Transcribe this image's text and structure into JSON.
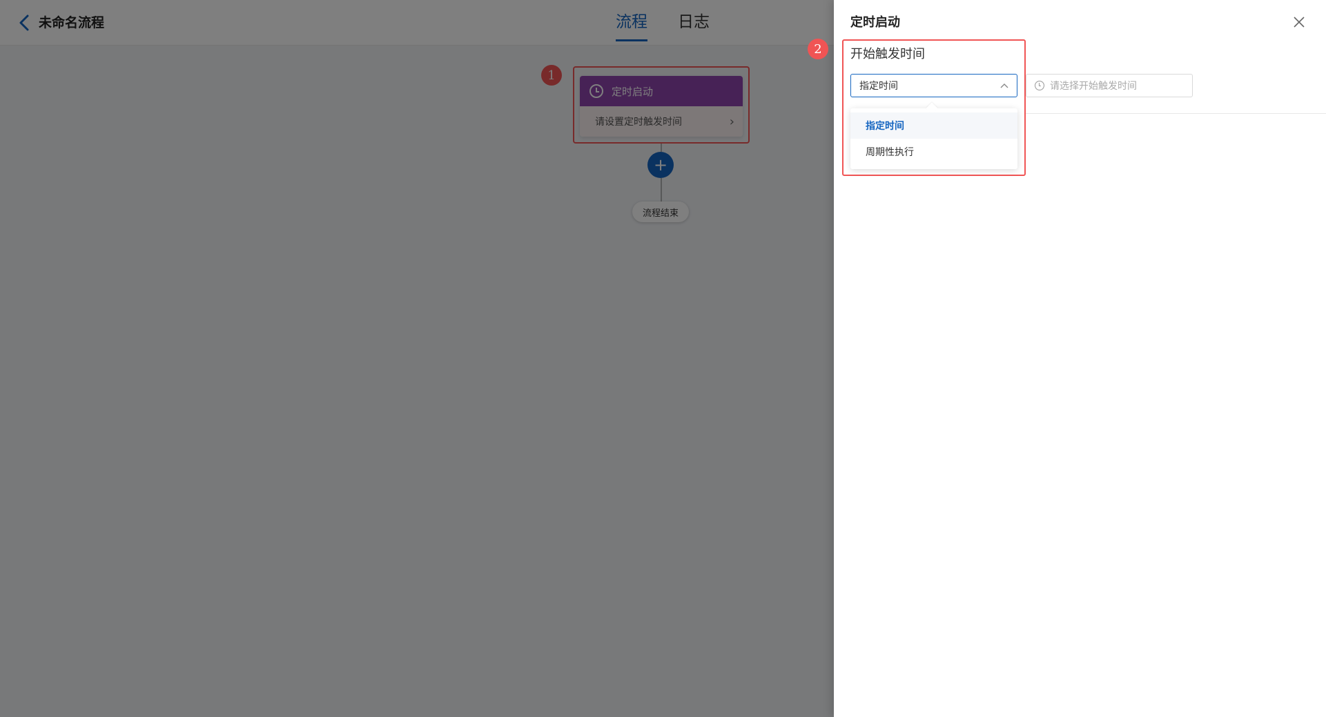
{
  "topbar": {
    "title": "未命名流程",
    "tabs": [
      {
        "label": "流程",
        "active": true
      },
      {
        "label": "日志",
        "active": false
      }
    ]
  },
  "flow": {
    "node": {
      "title": "定时启动",
      "subtitle": "请设置定时触发时间"
    },
    "add_label": "+",
    "end_label": "流程结束"
  },
  "annotations": {
    "badge1": "1",
    "badge2": "2"
  },
  "drawer": {
    "title": "定时启动",
    "field_label": "开始触发时间",
    "select_value": "指定时间",
    "date_placeholder": "请选择开始触发时间",
    "options": [
      {
        "label": "指定时间",
        "selected": true
      },
      {
        "label": "周期性执行",
        "selected": false
      }
    ]
  },
  "colors": {
    "accent": "#1565c0",
    "node_header": "#8e44ad",
    "highlight": "#f05454"
  }
}
